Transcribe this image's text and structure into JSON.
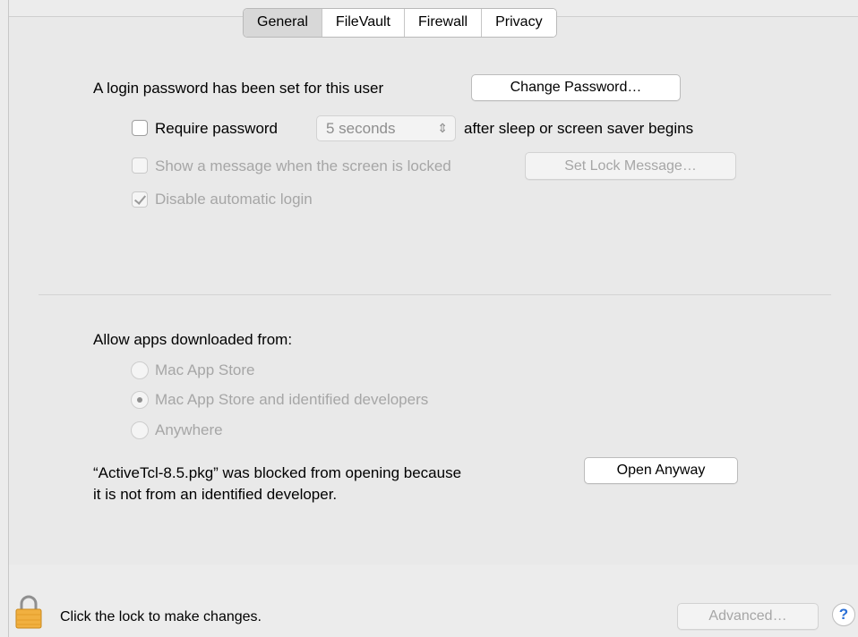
{
  "tabs": [
    "General",
    "FileVault",
    "Firewall",
    "Privacy"
  ],
  "active_tab": "General",
  "login": {
    "text": "A login password has been set for this user",
    "change_password_button": "Change Password…"
  },
  "require_password": {
    "label": "Require password",
    "checked": false,
    "delay_value": "5 seconds",
    "suffix": "after sleep or screen saver begins"
  },
  "show_message": {
    "label": "Show a message when the screen is locked",
    "checked": false,
    "enabled": false,
    "button": "Set Lock Message…"
  },
  "disable_auto_login": {
    "label": "Disable automatic login",
    "checked": true,
    "enabled": false
  },
  "gatekeeper": {
    "heading": "Allow apps downloaded from:",
    "options": [
      "Mac App Store",
      "Mac App Store and identified developers",
      "Anywhere"
    ],
    "selected_index": 1,
    "blocked_line1": "“ActiveTcl-8.5.pkg” was blocked from opening because",
    "blocked_line2": "it is not from an identified developer.",
    "open_anyway_button": "Open Anyway"
  },
  "footer": {
    "lock_text": "Click the lock to make changes.",
    "advanced_button": "Advanced…",
    "help_label": "?"
  },
  "colors": {
    "lock": "#f1b040",
    "help": "#2a6fd6"
  }
}
